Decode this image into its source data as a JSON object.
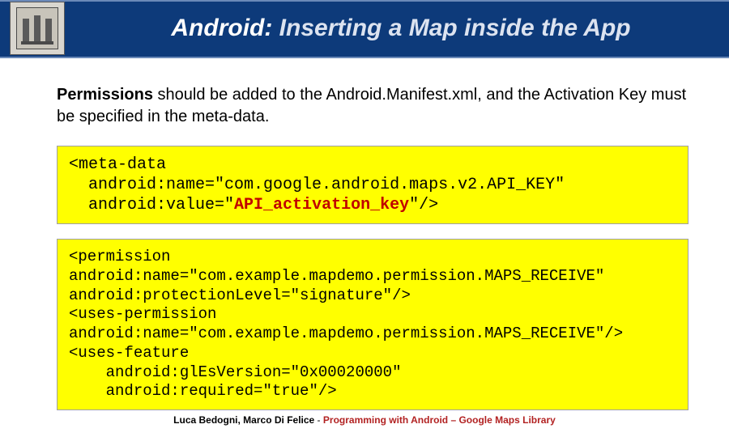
{
  "header": {
    "title_prefix": "Android:",
    "title_rest": " Inserting a Map inside the App",
    "seal_icon": "university-seal-icon"
  },
  "intro": {
    "bold": "Permissions",
    "rest": " should be added to the Android.Manifest.xml, and the Activation Key must be specified in the meta-data."
  },
  "code1": {
    "line1": "<meta-data",
    "line2_a": "  android:name=\"com.google.android.maps.v2.API_KEY\"",
    "line3_a": "  android:value=\"",
    "line3_key": "API_activation_key",
    "line3_b": "\"/>"
  },
  "code2": {
    "l1": "<permission",
    "l2": "android:name=\"com.example.mapdemo.permission.MAPS_RECEIVE\"",
    "l3": "android:protectionLevel=\"signature\"/>",
    "l4": "<uses-permission",
    "l5": "android:name=\"com.example.mapdemo.permission.MAPS_RECEIVE\"/>",
    "l6": "<uses-feature",
    "l7": "    android:glEsVersion=\"0x00020000\"",
    "l8": "    android:required=\"true\"/>"
  },
  "footer": {
    "authors": "Luca Bedogni, Marco Di Felice",
    "separator": " - ",
    "course": "Programming with Android – Google Maps Library"
  }
}
